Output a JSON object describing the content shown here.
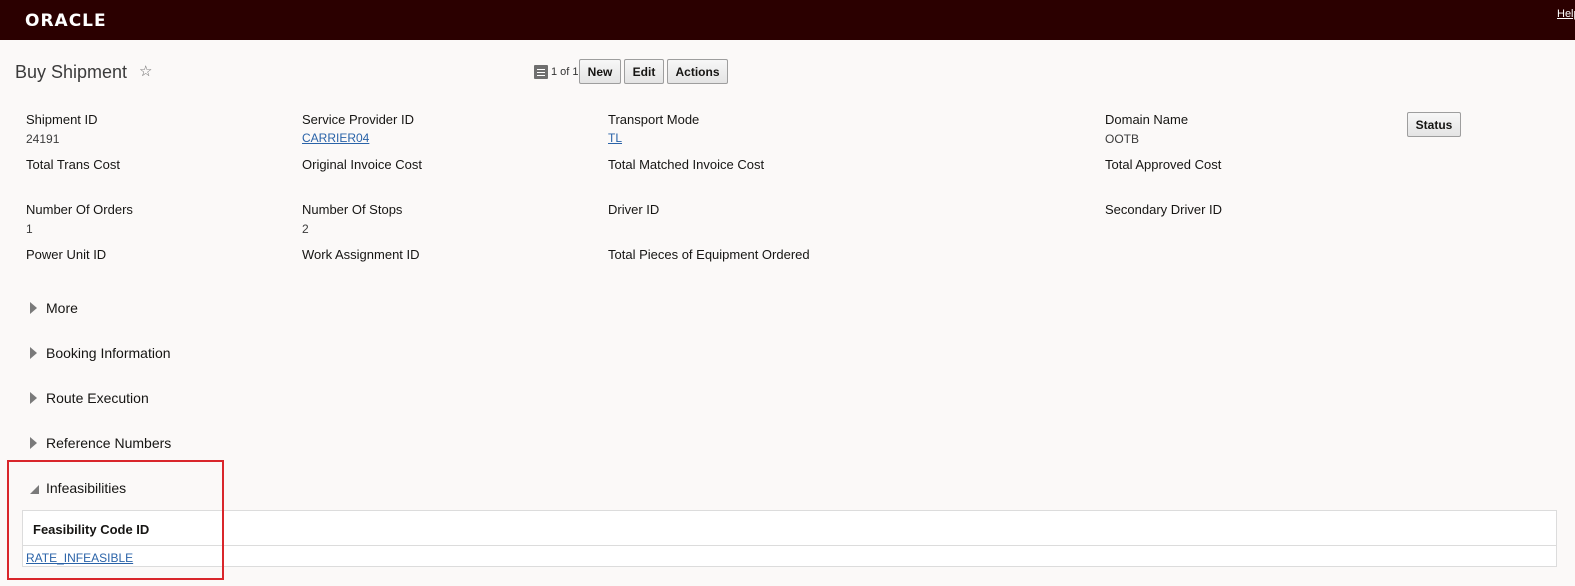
{
  "header": {
    "brand": "ORACLE",
    "help_link": "Help"
  },
  "page": {
    "title": "Buy Shipment",
    "pager_text": "1 of 1"
  },
  "toolbar": {
    "new_label": "New",
    "edit_label": "Edit",
    "actions_label": "Actions",
    "status_label": "Status"
  },
  "fields": {
    "shipment_id": {
      "label": "Shipment ID",
      "value": "24191"
    },
    "service_provider_id": {
      "label": "Service Provider ID",
      "value": "CARRIER04"
    },
    "transport_mode": {
      "label": "Transport Mode",
      "value": "TL"
    },
    "domain_name": {
      "label": "Domain Name",
      "value": "OOTB"
    },
    "total_trans_cost": {
      "label": "Total Trans Cost"
    },
    "original_invoice_cost": {
      "label": "Original Invoice Cost"
    },
    "total_matched_invoice_cost": {
      "label": "Total Matched Invoice Cost"
    },
    "total_approved_cost": {
      "label": "Total Approved Cost"
    },
    "number_of_orders": {
      "label": "Number Of Orders",
      "value": "1"
    },
    "number_of_stops": {
      "label": "Number Of Stops",
      "value": "2"
    },
    "driver_id": {
      "label": "Driver ID"
    },
    "secondary_driver_id": {
      "label": "Secondary Driver ID"
    },
    "power_unit_id": {
      "label": "Power Unit ID"
    },
    "work_assignment_id": {
      "label": "Work Assignment ID"
    },
    "total_pieces_equipment": {
      "label": "Total Pieces of Equipment Ordered"
    }
  },
  "sections": {
    "more": "More",
    "booking_information": "Booking Information",
    "route_execution": "Route Execution",
    "reference_numbers": "Reference Numbers",
    "infeasibilities": "Infeasibilities"
  },
  "infeasibilities_table": {
    "column_header": "Feasibility Code ID",
    "rows": [
      "RATE_INFEASIBLE"
    ]
  }
}
